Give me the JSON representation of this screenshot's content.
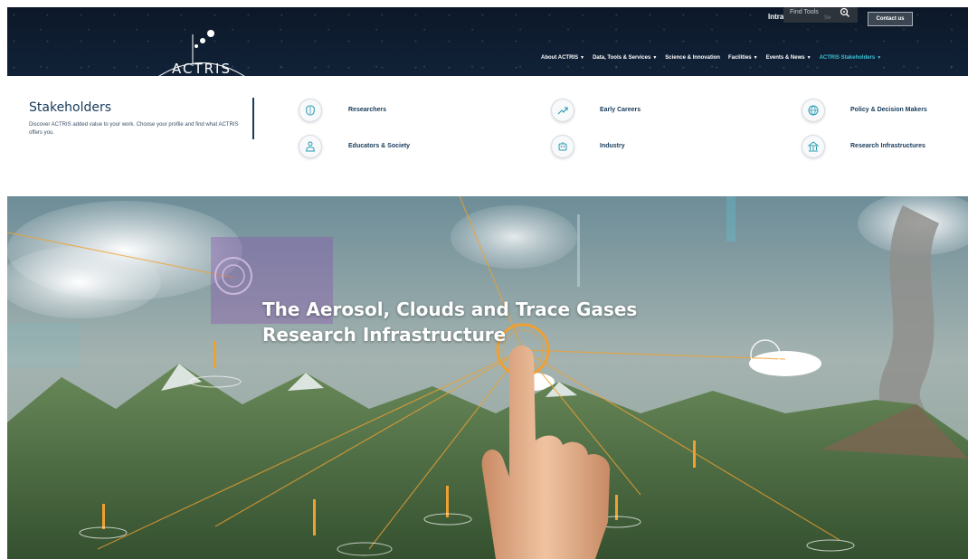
{
  "header": {
    "logo_text": "ACTRIS",
    "intranet_label": "Intra",
    "intranet_tail": "t",
    "find_tools_label": "Find Tools",
    "find_tools_sub": "Se",
    "contact_label": "Contact us",
    "nav": [
      {
        "label": "About ACTRIS",
        "has_caret": true,
        "active": false
      },
      {
        "label": "Data, Tools & Services",
        "has_caret": true,
        "active": false
      },
      {
        "label": "Science & Innovation",
        "has_caret": false,
        "active": false
      },
      {
        "label": "Facilities",
        "has_caret": true,
        "active": false
      },
      {
        "label": "Events & News",
        "has_caret": true,
        "active": false
      },
      {
        "label": "ACTRIS Stakeholders",
        "has_caret": true,
        "active": true
      }
    ],
    "active_color": "#3cc0d6"
  },
  "mega_menu": {
    "title": "Stakeholders",
    "description": "Discover ACTRIS added value to your work. Choose your profile and find what ACTRIS offers you.",
    "items": [
      {
        "label": "Researchers",
        "icon": "brain-icon"
      },
      {
        "label": "Early Careers",
        "icon": "growth-icon"
      },
      {
        "label": "Policy & Decision Makers",
        "icon": "globe-icon"
      },
      {
        "label": "Educators & Society",
        "icon": "people-icon"
      },
      {
        "label": "Industry",
        "icon": "robot-icon"
      },
      {
        "label": "Research Infrastructures",
        "icon": "building-icon"
      }
    ]
  },
  "hero": {
    "title_line1": "The Aerosol, Clouds and Trace Gases",
    "title_line2": "Research Infrastructure"
  }
}
